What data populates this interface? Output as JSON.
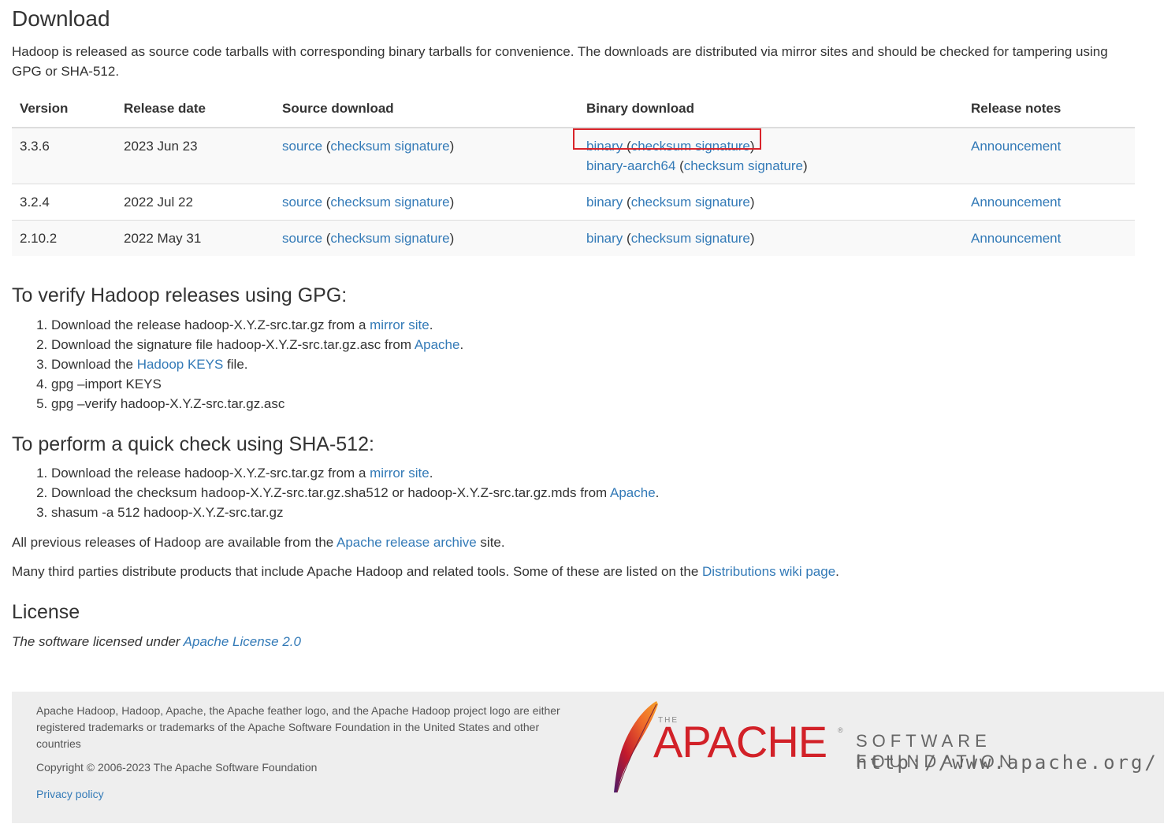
{
  "download": {
    "title": "Download",
    "intro": "Hadoop is released as source code tarballs with corresponding binary tarballs for convenience. The downloads are distributed via mirror sites and should be checked for tampering using GPG or SHA-512."
  },
  "table": {
    "headers": [
      "Version",
      "Release date",
      "Source download",
      "Binary download",
      "Release notes"
    ],
    "rows": [
      {
        "version": "3.3.6",
        "date": "2023 Jun 23",
        "source": "source",
        "source_sig": "checksum signature",
        "binary": "binary",
        "binary_sig": "checksum signature",
        "binary2": "binary-aarch64",
        "binary2_sig": "checksum signature",
        "notes": "Announcement"
      },
      {
        "version": "3.2.4",
        "date": "2022 Jul 22",
        "source": "source",
        "source_sig": "checksum signature",
        "binary": "binary",
        "binary_sig": "checksum signature",
        "notes": "Announcement"
      },
      {
        "version": "2.10.2",
        "date": "2022 May 31",
        "source": "source",
        "source_sig": "checksum signature",
        "binary": "binary",
        "binary_sig": "checksum signature",
        "notes": "Announcement"
      }
    ],
    "highlight_color": "#d9242b"
  },
  "gpg": {
    "title": "To verify Hadoop releases using GPG:",
    "s1_pre": "Download the release hadoop-X.Y.Z-src.tar.gz from a ",
    "s1_link": "mirror site",
    "s1_post": ".",
    "s2_pre": "Download the signature file hadoop-X.Y.Z-src.tar.gz.asc from ",
    "s2_link": "Apache",
    "s2_post": ".",
    "s3_pre": "Download the ",
    "s3_link": "Hadoop KEYS",
    "s3_post": " file.",
    "s4": "gpg –import KEYS",
    "s5": "gpg –verify hadoop-X.Y.Z-src.tar.gz.asc"
  },
  "sha": {
    "title": "To perform a quick check using SHA-512:",
    "s1_pre": "Download the release hadoop-X.Y.Z-src.tar.gz from a ",
    "s1_link": "mirror site",
    "s1_post": ".",
    "s2_pre": "Download the checksum hadoop-X.Y.Z-src.tar.gz.sha512 or hadoop-X.Y.Z-src.tar.gz.mds from ",
    "s2_link": "Apache",
    "s2_post": ".",
    "s3": "shasum -a 512 hadoop-X.Y.Z-src.tar.gz"
  },
  "archive": {
    "pre": "All previous releases of Hadoop are available from the ",
    "link": "Apache release archive",
    "post": " site."
  },
  "thirdparty": {
    "pre": "Many third parties distribute products that include Apache Hadoop and related tools. Some of these are listed on the ",
    "link": "Distributions wiki page",
    "post": "."
  },
  "license": {
    "title": "License",
    "pre": "The software licensed under ",
    "link": "Apache License 2.0"
  },
  "footer": {
    "trademark": "Apache Hadoop, Hadoop, Apache, the Apache feather logo, and the Apache Hadoop project logo are either registered trademarks or trademarks of the Apache Software Foundation in the United States and other countries",
    "copyright": "Copyright © 2006-2023 The Apache Software Foundation",
    "privacy": "Privacy policy",
    "logo_the": "THE",
    "logo_apache": "APACHE",
    "logo_reg": "®",
    "logo_sf": "SOFTWARE FOUNDATION",
    "logo_url": "http://www.apache.org/"
  },
  "colors": {
    "link": "#337ab7",
    "text": "#333333",
    "footer_bg": "#eeeeee",
    "apache_red": "#d22128"
  },
  "icons": {
    "feather": "apache-feather-icon"
  }
}
